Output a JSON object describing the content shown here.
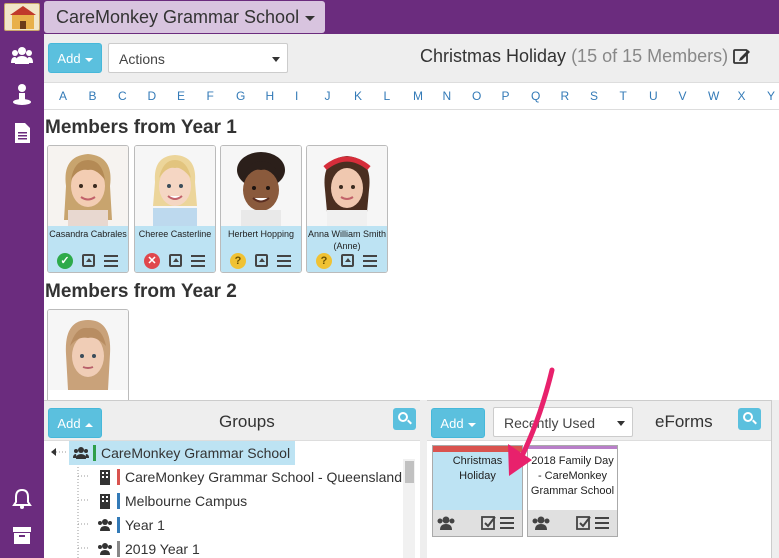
{
  "topbar": {
    "school_name": "CareMonkey Grammar School"
  },
  "sidebar": {
    "icons": [
      "users-icon",
      "person-icon",
      "document-icon",
      "bell-icon",
      "archive-icon"
    ]
  },
  "header": {
    "add_label": "Add",
    "actions_label": "Actions",
    "group_title": "Christmas Holiday",
    "member_count": "(15 of 15 Members)"
  },
  "alphabet": [
    "A",
    "B",
    "C",
    "D",
    "E",
    "F",
    "G",
    "H",
    "I",
    "J",
    "K",
    "L",
    "M",
    "N",
    "O",
    "P",
    "Q",
    "R",
    "S",
    "T",
    "U",
    "V",
    "W",
    "X",
    "Y"
  ],
  "members": {
    "section1": "Members from Year 1",
    "section2": "Members from Year 2",
    "year1": [
      {
        "name": "Casandra Cabrales",
        "status": "approved"
      },
      {
        "name": "Cheree Casterline",
        "status": "declined"
      },
      {
        "name": "Herbert Hopping",
        "status": "pending"
      },
      {
        "name": "Anna William Smith (Anne)",
        "status": "pending"
      }
    ]
  },
  "groups_panel": {
    "add_label": "Add",
    "title": "Groups",
    "items": [
      {
        "label": "CareMonkey Grammar School",
        "color": "#2e9e4a"
      },
      {
        "label": "CareMonkey Grammar School - Queensland",
        "color": "#d9534f"
      },
      {
        "label": "Melbourne Campus",
        "color": "#337ab7"
      },
      {
        "label": "Year 1",
        "color": "#337ab7"
      },
      {
        "label": "2019 Year 1",
        "color": "#888888"
      }
    ]
  },
  "eforms_panel": {
    "add_label": "Add",
    "filter_label": "Recently Used",
    "title": "eForms",
    "items": [
      {
        "title": "Christmas Holiday",
        "accent": "#d9534f"
      },
      {
        "title": "2018 Family Day - CareMonkey Grammar School",
        "accent": "#b97fc9"
      }
    ]
  },
  "colors": {
    "brand": "#6b2c7e",
    "accent": "#5bc0de",
    "arrow": "#e8216c"
  }
}
